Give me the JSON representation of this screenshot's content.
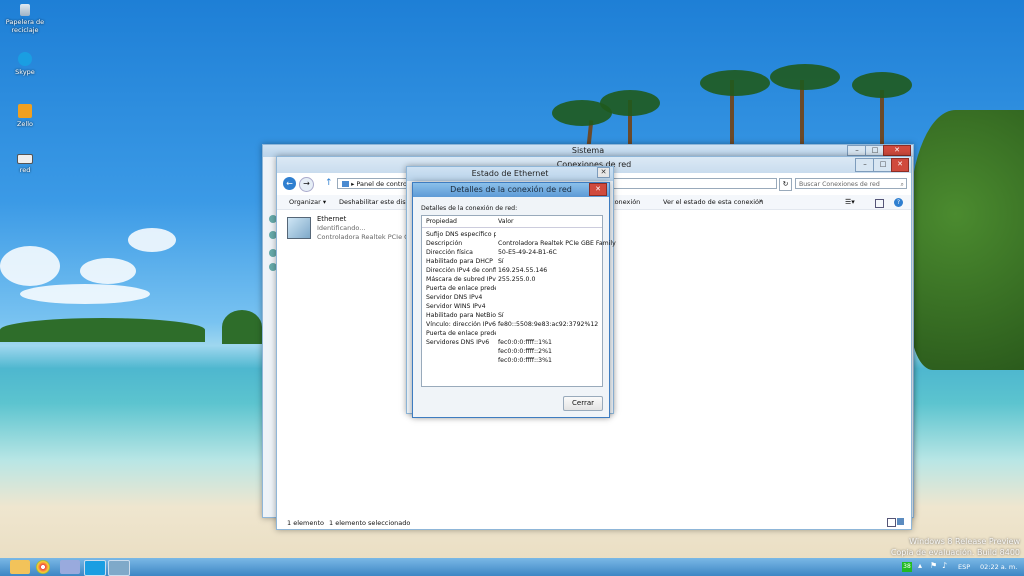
{
  "desktop": {
    "icons": [
      {
        "label": "Papelera de reciclaje"
      },
      {
        "label": "Skype"
      },
      {
        "label": "Zello"
      },
      {
        "label": "red"
      }
    ]
  },
  "sistema": {
    "title": "Sistema"
  },
  "conexiones": {
    "title": "Conexiones de red",
    "address": "Panel de control",
    "search_placeholder": "Buscar Conexiones de red",
    "toolbar": {
      "organizar": "Organizar",
      "deshabilitar": "Deshabilitar este dispositivo",
      "cambiar": "conexión",
      "ver_estado": "Ver el estado de esta conexión",
      "mas": "»"
    },
    "item": {
      "name": "Ethernet",
      "status": "Identificando...",
      "adapter": "Controladora Realtek PCIe GBE F"
    },
    "status_bar": {
      "count": "1 elemento",
      "selected": "1 elemento seleccionado"
    }
  },
  "estado": {
    "title": "Estado de Ethernet"
  },
  "detalles": {
    "title": "Detalles de la conexión de red",
    "group_label": "Detalles de la conexión de red:",
    "columns": [
      "Propiedad",
      "Valor"
    ],
    "rows": [
      [
        "Sufijo DNS específico p...",
        ""
      ],
      [
        "Descripción",
        "Controladora Realtek PCIe GBE Family"
      ],
      [
        "Dirección física",
        "50-E5-49-24-B1-6C"
      ],
      [
        "Habilitado para DHCP",
        "Sí"
      ],
      [
        "Dirección IPv4 de config...",
        "169.254.55.146"
      ],
      [
        "Máscara de subred IPv4",
        "255.255.0.0"
      ],
      [
        "Puerta de enlace predet...",
        ""
      ],
      [
        "Servidor DNS IPv4",
        ""
      ],
      [
        "Servidor WINS IPv4",
        ""
      ],
      [
        "Habilitado para NetBios ...",
        "Sí"
      ],
      [
        "Vínculo: dirección IPv6 l...",
        "fe80::5508:9e83:ac92:3792%12"
      ],
      [
        "Puerta de enlace predet...",
        ""
      ],
      [
        "Servidores DNS IPv6",
        "fec0:0:0:ffff::1%1"
      ],
      [
        "",
        "fec0:0:0:ffff::2%1"
      ],
      [
        "",
        "fec0:0:0:ffff::3%1"
      ]
    ],
    "close_button": "Cerrar"
  },
  "watermark": {
    "line1": "Windows 8 Release Preview",
    "line2": "Copia de evaluación. Build 8400"
  },
  "taskbar": {
    "lang": "ESP",
    "time": "02:22 a. m.",
    "badge": "38"
  }
}
